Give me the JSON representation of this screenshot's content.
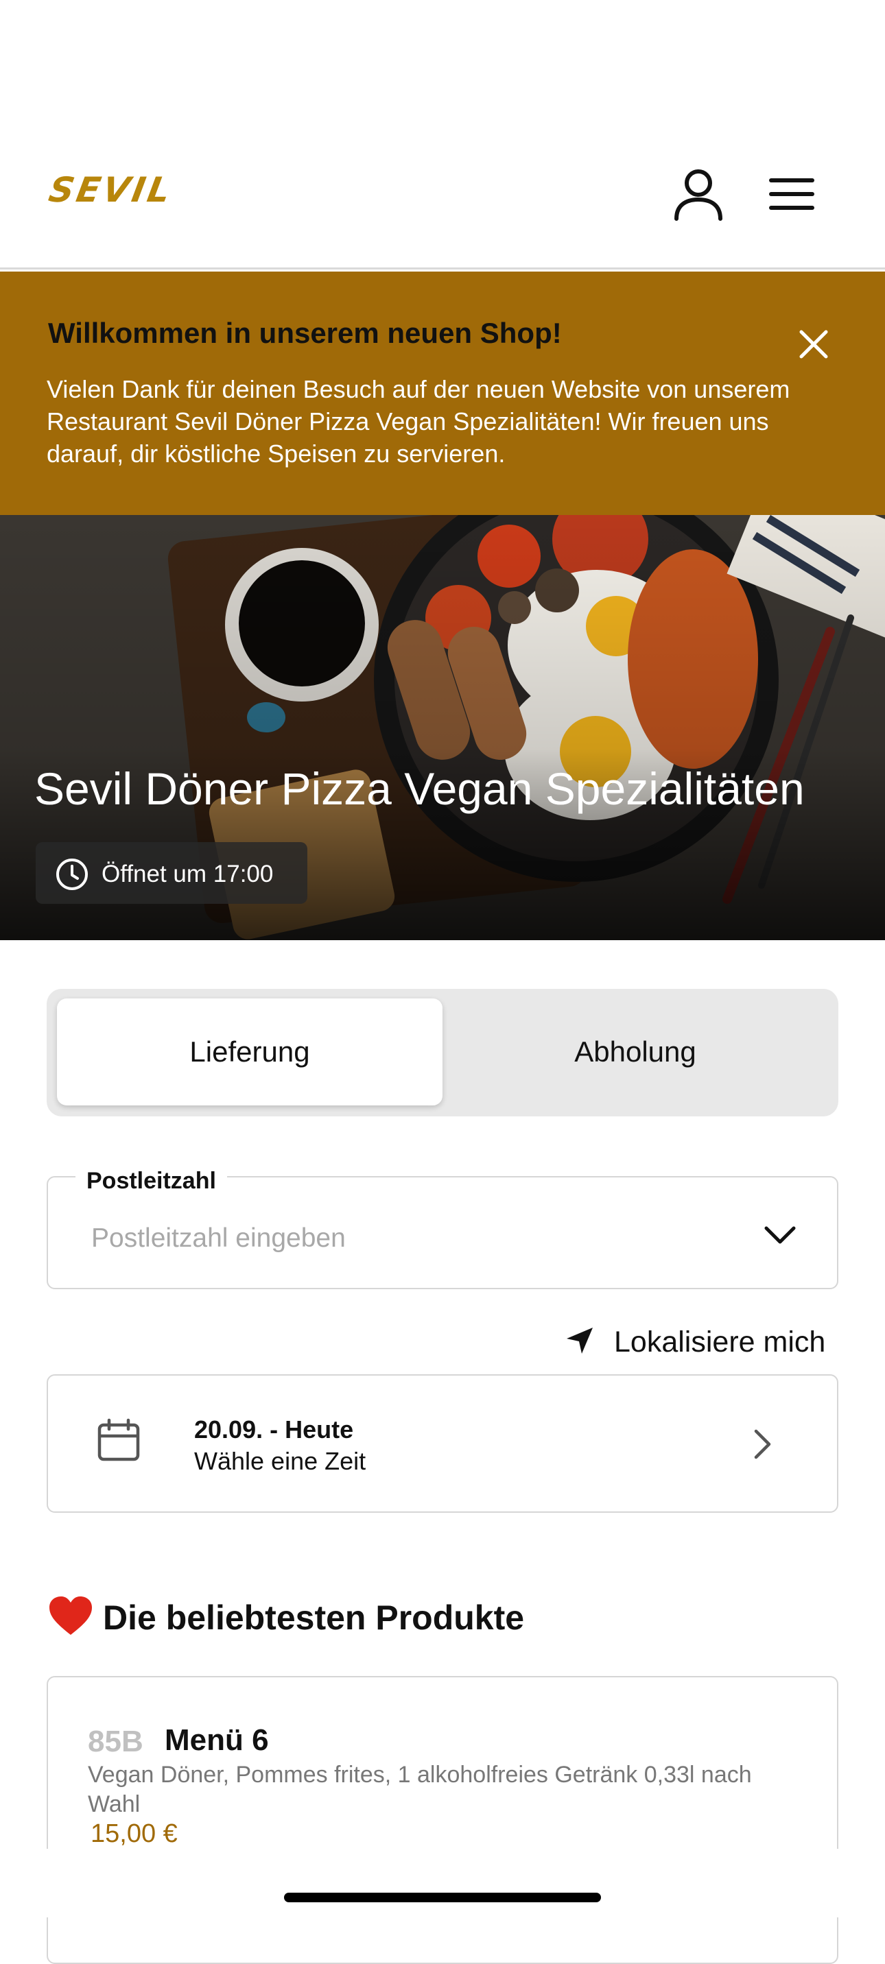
{
  "header": {
    "logo": "SEVIL",
    "icons": {
      "account": "user-icon",
      "menu": "hamburger-menu-icon"
    }
  },
  "banner": {
    "title": "Willkommen in unserem neuen Shop!",
    "text": "Vielen Dank für deinen Besuch auf der neuen Website von unserem Restaurant Sevil Döner Pizza Vegan Spezialitäten! Wir freuen uns darauf, dir köstliche Speisen zu servieren.",
    "close_icon": "close-icon",
    "color": "#a06a08"
  },
  "hero": {
    "title": "Sevil Döner Pizza Vegan Spezialitäten",
    "status": "Öffnet um 17:00",
    "status_icon": "clock-icon"
  },
  "order_mode": {
    "options": [
      "Lieferung",
      "Abholung"
    ],
    "selected": "Lieferung"
  },
  "postcode": {
    "label": "Postleitzahl",
    "placeholder": "Postleitzahl eingeben",
    "value": ""
  },
  "locate": {
    "label": "Lokalisiere mich",
    "icon": "location-arrow-icon"
  },
  "delivery_time": {
    "date": "20.09. - Heute",
    "hint": "Wähle eine Zeit",
    "icon": "calendar-icon"
  },
  "popular": {
    "emoji": "❤️",
    "title": "Die beliebtesten Produkte",
    "products": [
      {
        "number": "85B",
        "name": "Menü 6",
        "description": "Vegan Döner, Pommes frites, 1 alkoholfreies Getränk 0,33l nach Wahl",
        "price": "15,00 €"
      }
    ]
  },
  "colors": {
    "accent": "#a06a08",
    "logo": "#b8860b"
  }
}
